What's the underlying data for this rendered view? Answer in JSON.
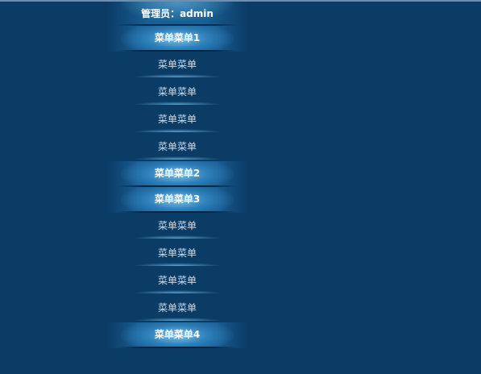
{
  "header": {
    "admin_label": "管理员：admin"
  },
  "menu": {
    "sections": [
      {
        "label": "菜单菜单1",
        "items": [
          "菜单菜单",
          "菜单菜单",
          "菜单菜单",
          "菜单菜单"
        ]
      },
      {
        "label": "菜单菜单2",
        "items": []
      },
      {
        "label": "菜单菜单3",
        "items": [
          "菜单菜单",
          "菜单菜单",
          "菜单菜单",
          "菜单菜单"
        ]
      },
      {
        "label": "菜单菜单4",
        "items": []
      }
    ]
  },
  "colors": {
    "background": "#0b3c66",
    "header_text": "#ffffff",
    "item_text": "#c9dcec",
    "glow": "#8cd7fa"
  }
}
